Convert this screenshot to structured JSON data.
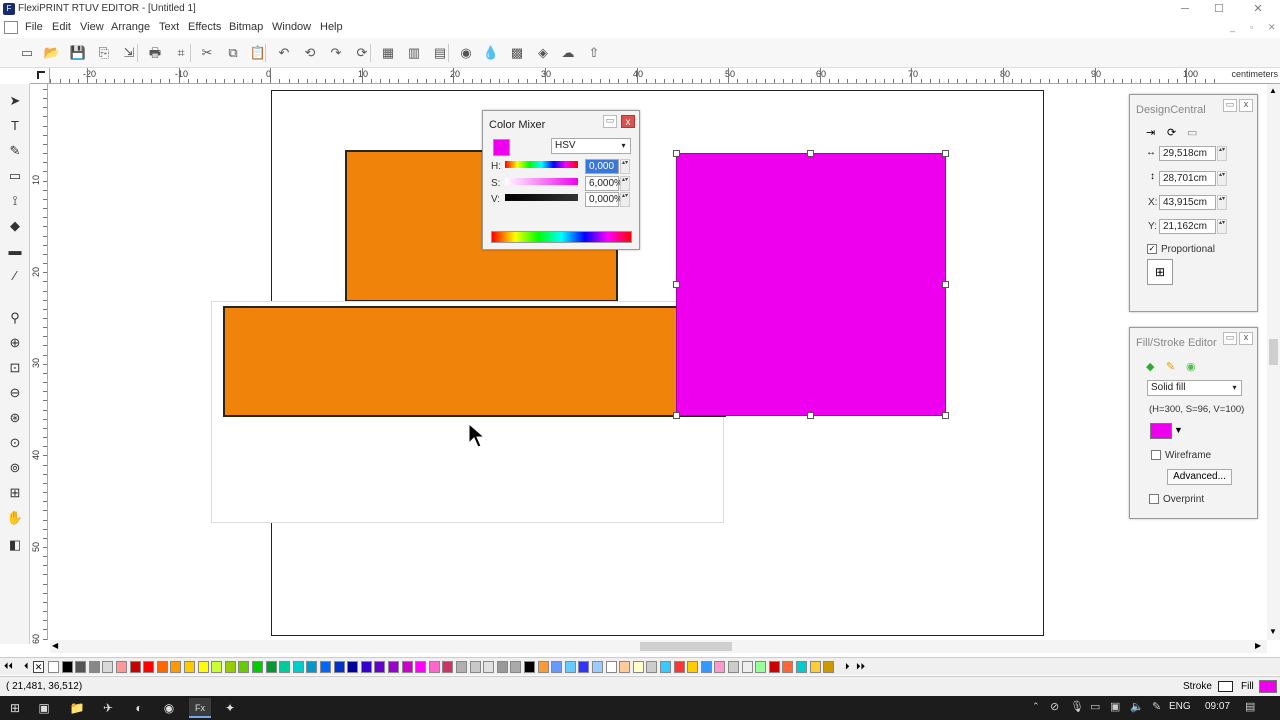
{
  "app": {
    "title": "FlexiPRINT RTUV EDITOR - [Untitled 1]",
    "icon": "app-logo-icon"
  },
  "window_controls": {
    "minimize": "─",
    "maximize": "☐",
    "close": "✕"
  },
  "menu": [
    "File",
    "Edit",
    "View",
    "Arrange",
    "Text",
    "Effects",
    "Bitmap",
    "Window",
    "Help"
  ],
  "mdi_controls": {
    "minimize": "_",
    "restore": "▫",
    "close": "✕"
  },
  "toolbar": {
    "icons": [
      "new-icon",
      "open-icon",
      "save-icon",
      "save-as-icon",
      "import-icon",
      "print-icon",
      "cut-plot-icon",
      "scissors-icon",
      "copy-icon",
      "paste-icon",
      "undo-icon",
      "undo-all-icon",
      "redo-icon",
      "redo-all-icon",
      "group-icon",
      "ungroup-icon",
      "weld-icon",
      "color-wheel-icon",
      "inkdrop-icon",
      "swatch-grid-icon",
      "color-mixer-icon",
      "cloud-icon",
      "cloud-upload-icon"
    ],
    "glyphs": [
      "▭",
      "📂",
      "💾",
      "⎘",
      "⇲",
      "🖶",
      "⌗",
      "✂",
      "⧉",
      "📋",
      "↶",
      "⟲",
      "↷",
      "⟳",
      "▦",
      "▥",
      "▤",
      "◉",
      "💧",
      "▩",
      "◈",
      "☁",
      "⇧"
    ]
  },
  "ruler": {
    "unit": "centimeters",
    "h_labels": [
      "-20",
      "-10",
      "0",
      "10",
      "20",
      "30",
      "40",
      "50",
      "60",
      "70",
      "80",
      "90",
      "100"
    ],
    "v_labels": [
      "10",
      "20",
      "30",
      "40",
      "50",
      "60"
    ]
  },
  "tools": {
    "icons": [
      "pointer-icon",
      "text-icon",
      "pen-icon",
      "shape-icon",
      "node-edit-icon",
      "fill-tool-icon",
      "measure-icon",
      "eyedropper-icon",
      "zoom-tool-icon",
      "zoom-in-icon",
      "zoom-page-icon",
      "zoom-out-icon",
      "zoom-all-icon",
      "zoom-previous-icon",
      "zoom-selection-icon",
      "zoom-actual-icon",
      "pan-hand-icon",
      "fill-stroke-tool-icon"
    ],
    "glyphs": [
      "➤",
      "T",
      "✎",
      "▭",
      "⟟",
      "◆",
      "▬",
      "⁄",
      "⚲",
      "⊕",
      "⊡",
      "⊖",
      "⊛",
      "⊙",
      "⊚",
      "⊞",
      "✋",
      "◧"
    ]
  },
  "color_mixer": {
    "title": "Color Mixer",
    "mode": "HSV",
    "h_label": "H:",
    "s_label": "S:",
    "v_label": "V:",
    "h_value": "0,000",
    "s_value": "6,000%",
    "v_value": "0,000%",
    "current_color": "#ee00ee"
  },
  "design_central": {
    "title": "DesignCentral",
    "width": "29,518cm",
    "height": "28,701cm",
    "x_label": "X:",
    "x": "43,915cm",
    "y_label": "Y:",
    "y": "21,162cm",
    "proportional": "Proportional",
    "tab_icons": [
      "position-tab-icon",
      "rotate-tab-icon",
      "shape-tab-icon"
    ]
  },
  "fill_stroke": {
    "title": "Fill/Stroke Editor",
    "fill_type": "Solid fill",
    "hsv_readout": "(H=300, S=96, V=100)",
    "swatch_color": "#ee00ee",
    "wireframe": "Wireframe",
    "advanced": "Advanced...",
    "overprint": "Overprint"
  },
  "palette": {
    "colors": [
      "#ffffff",
      "#000000",
      "#555555",
      "#888888",
      "#d9d9d9",
      "#ff9999",
      "#cc0000",
      "#ff0000",
      "#ff6600",
      "#ff9900",
      "#ffcc00",
      "#ffff00",
      "#ccff33",
      "#99cc00",
      "#66cc00",
      "#00cc00",
      "#009933",
      "#00cc99",
      "#00cccc",
      "#0099cc",
      "#0066ff",
      "#0033cc",
      "#000099",
      "#3300cc",
      "#6600cc",
      "#9900cc",
      "#cc00cc",
      "#ff00ff",
      "#ff66cc",
      "#cc3366",
      "#b0b0b0",
      "#c8c8c8",
      "#e0e0e0",
      "#999999",
      "#aaaaaa",
      "#000000",
      "#ff9933",
      "#6699ff",
      "#66ccff",
      "#3333ff",
      "#99ccff",
      "#ffffff",
      "#ffcc99",
      "#ffffcc",
      "#cccccc",
      "#33ccff",
      "#ff3333",
      "#ffcc00",
      "#3399ff",
      "#ff99cc",
      "#cccccc",
      "#eeeeee",
      "#99ff99",
      "#cc0000",
      "#ff6633",
      "#00cccc",
      "#ffcc33",
      "#cc9900"
    ]
  },
  "status": {
    "coords": "( 21,481,   36,512)",
    "stroke_label": "Stroke",
    "fill_label": "Fill"
  },
  "taskbar": {
    "icons": [
      "start-icon",
      "task-view-icon",
      "file-explorer-icon",
      "thunderbird-icon",
      "firefox-icon",
      "chrome-icon",
      "flexi-taskbar-icon",
      "production-manager-icon"
    ],
    "glyphs": [
      "⊞",
      "▣",
      "📁",
      "✈",
      "◐",
      "◉",
      "Fx",
      "✦"
    ],
    "lang": "ENG",
    "time": "09:07"
  }
}
